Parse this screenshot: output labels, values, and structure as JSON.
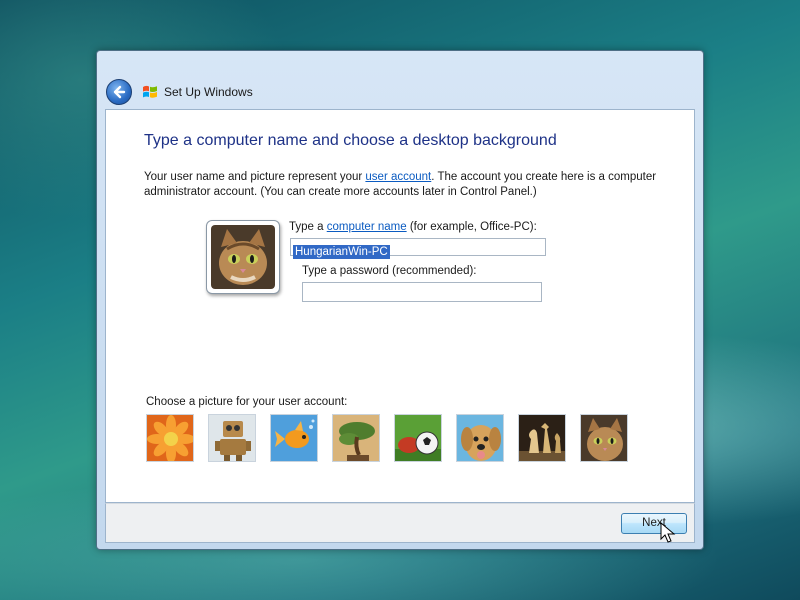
{
  "window": {
    "title": "Set Up Windows"
  },
  "content": {
    "heading": "Type a computer name and choose a desktop background",
    "intro_part1": "Your user name and picture represent your ",
    "intro_link": "user account",
    "intro_part2": ". The account you create here is a computer administrator account. (You can create more accounts later in Control Panel.)",
    "name_label_prefix": "Type a ",
    "name_label_link": "computer name",
    "name_label_suffix": " (for example, Office-PC):",
    "computer_name_value": "HungarianWin-PC",
    "password_label": "Type a password (recommended):",
    "password_value": "",
    "choose_picture_label": "Choose a picture for your user account:",
    "pictures": [
      "flower",
      "robot",
      "fish",
      "bonsai-tree",
      "soccer-ball",
      "dog",
      "chess",
      "kitten"
    ],
    "selected_picture": "kitten"
  },
  "footer": {
    "next_label": "Next"
  },
  "icons": {
    "back": "back-arrow-icon",
    "windows_logo": "windows-logo-icon",
    "cursor": "mouse-pointer-icon"
  },
  "colors": {
    "heading": "#1e3287",
    "link": "#0b5bc1",
    "selection": "#3169c6"
  }
}
